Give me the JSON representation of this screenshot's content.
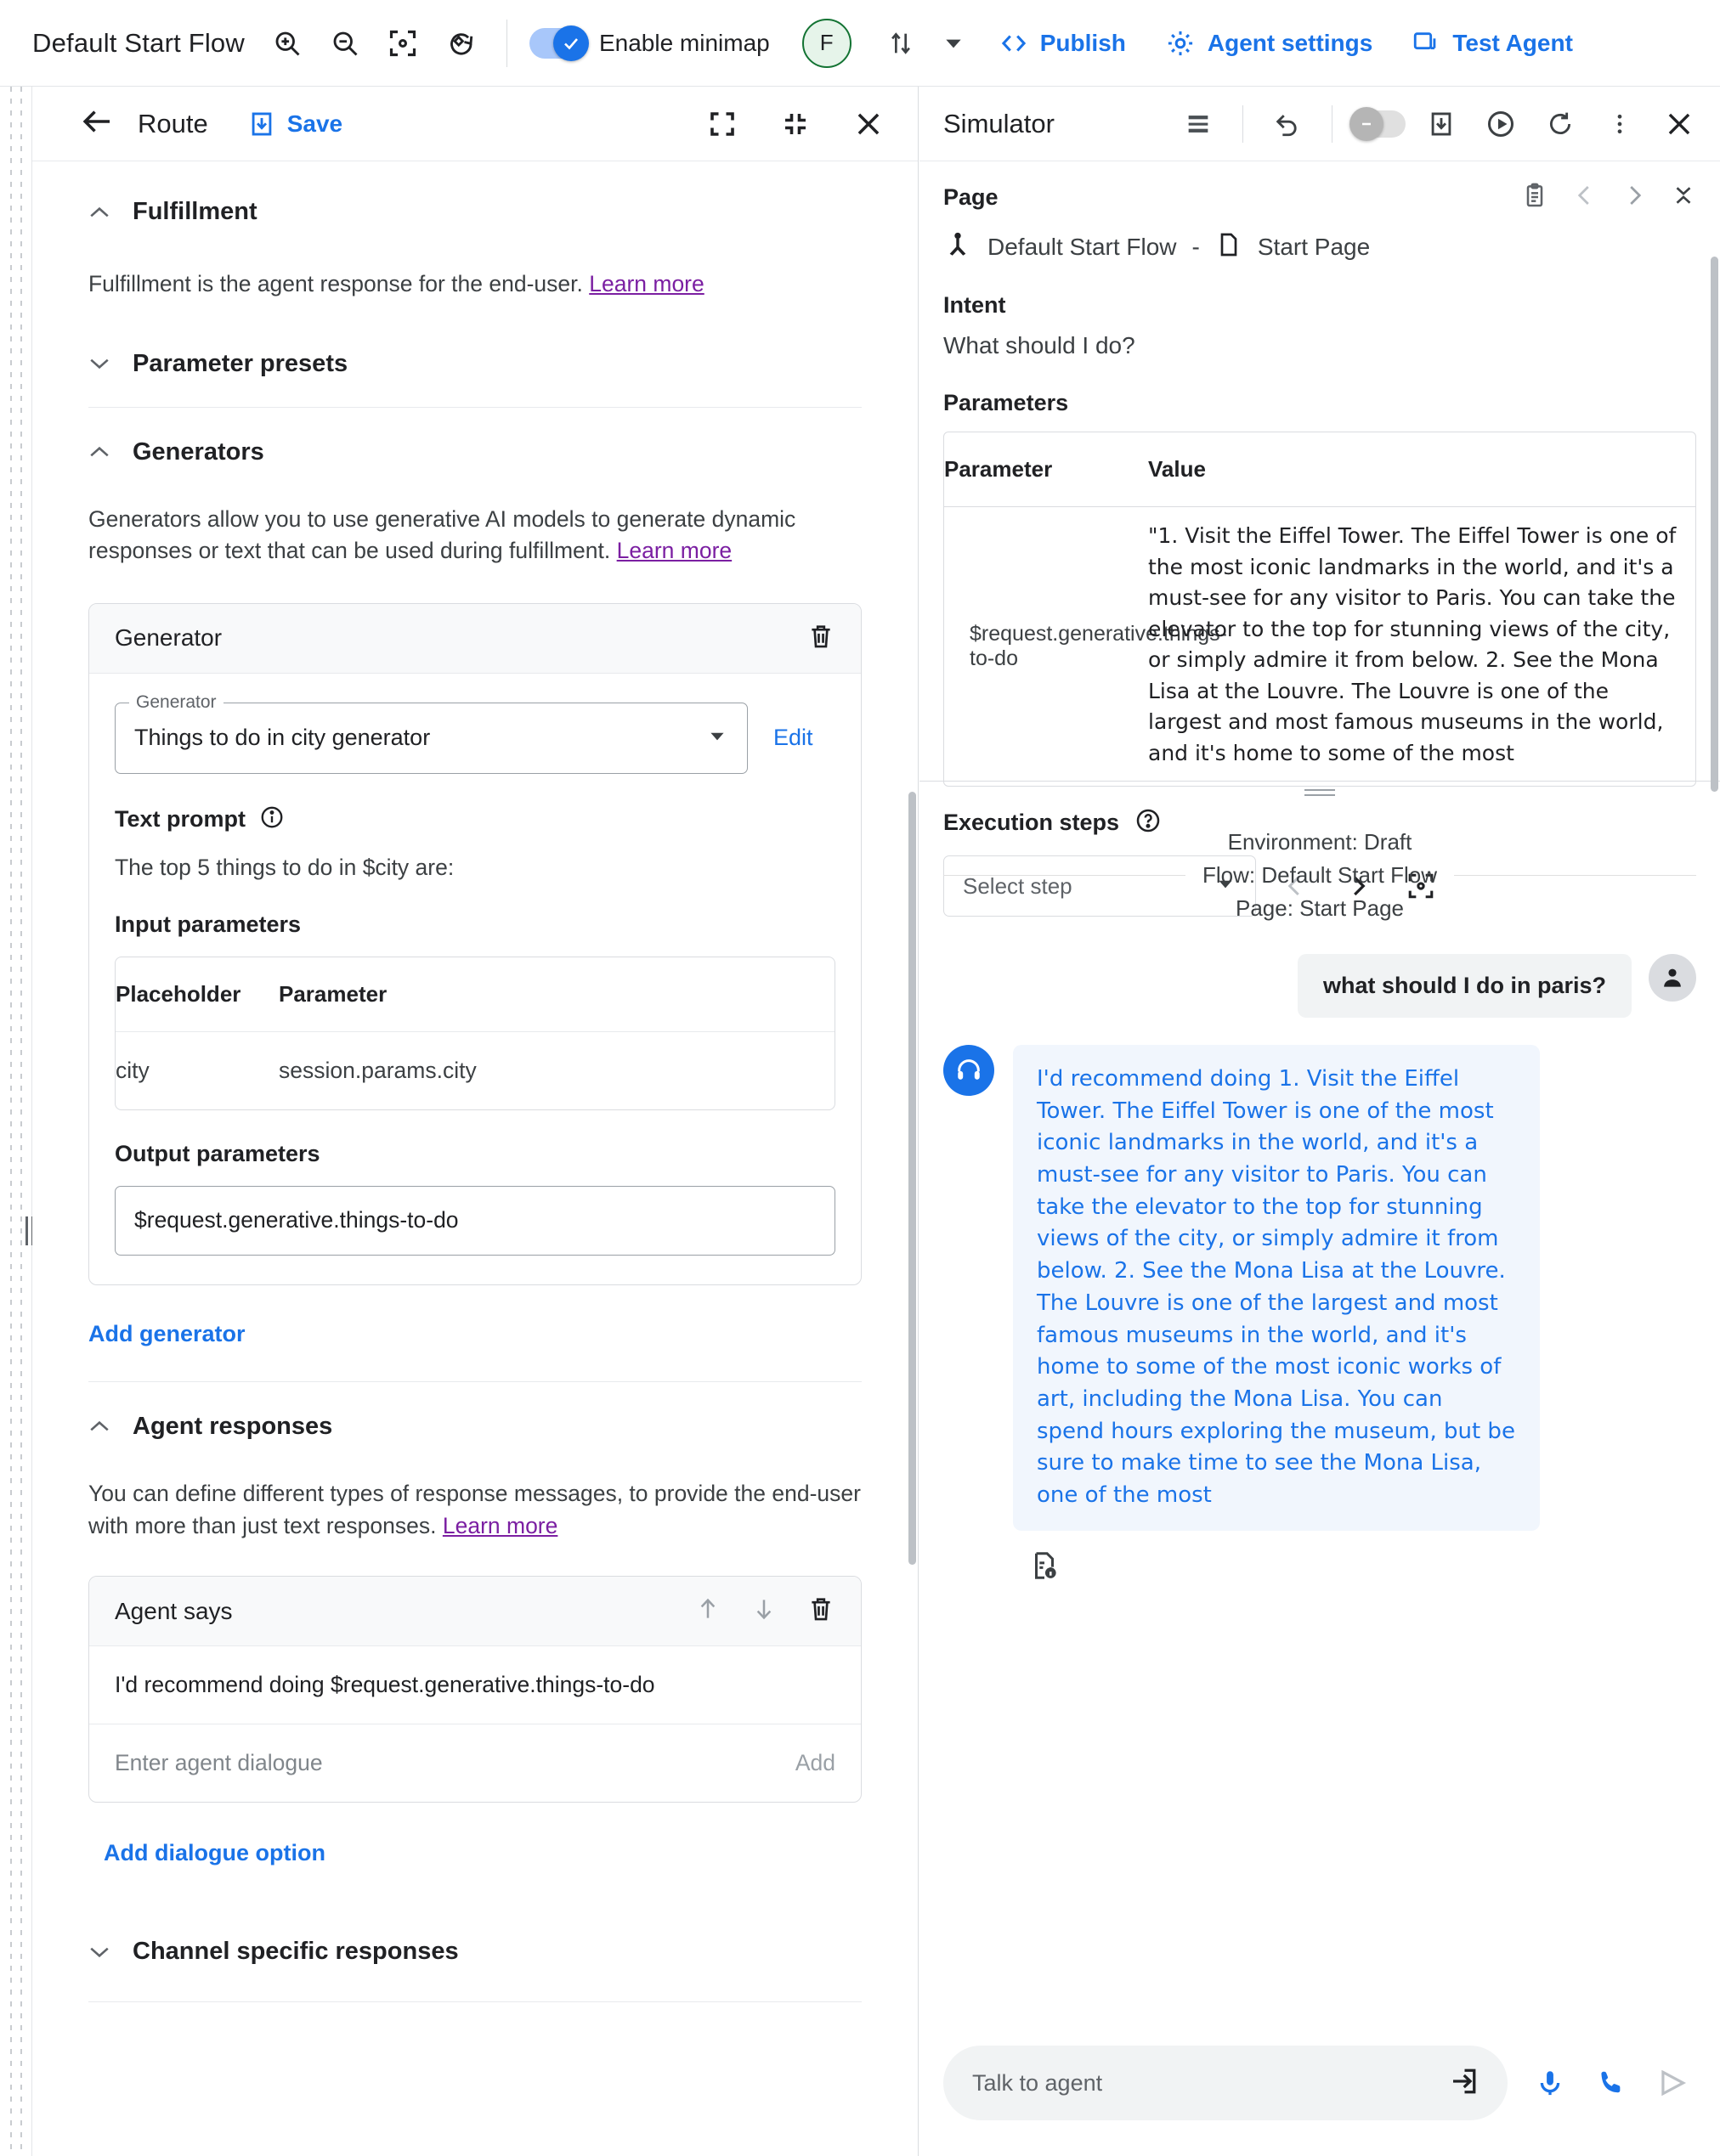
{
  "topbar": {
    "flow_title": "Default Start Flow",
    "icons": [
      "zoom-in-icon",
      "zoom-out-icon",
      "fit-to-screen-icon",
      "reset-view-icon"
    ],
    "minimap_label": "Enable minimap",
    "minimap_enabled": true,
    "avatar_initial": "F",
    "version_label": "",
    "publish_label": "Publish",
    "agent_settings_label": "Agent settings",
    "test_agent_label": "Test Agent",
    "accent_color": "#1a73e8"
  },
  "route": {
    "title": "Route",
    "save_label": "Save",
    "fulfillment": {
      "title": "Fulfillment",
      "description": "Fulfillment is the agent response for the end-user.",
      "learn_more": "Learn more"
    },
    "parameter_presets": {
      "title": "Parameter presets"
    },
    "generators": {
      "title": "Generators",
      "description": "Generators allow you to use generative AI models to generate dynamic responses or text that can be used during fulfillment.",
      "learn_more": "Learn more",
      "card_title": "Generator",
      "field_legend": "Generator",
      "field_value": "Things to do in city generator",
      "edit_label": "Edit",
      "text_prompt_label": "Text prompt",
      "prompt_value": "The top 5 things to do in $city are:",
      "input_parameters_label": "Input parameters",
      "input_table": {
        "headers": [
          "Placeholder",
          "Parameter"
        ],
        "rows": [
          [
            "city",
            "session.params.city"
          ]
        ]
      },
      "output_parameters_label": "Output parameters",
      "output_value": "$request.generative.things-to-do",
      "add_generator_label": "Add generator"
    },
    "agent_responses": {
      "title": "Agent responses",
      "description": "You can define different types of response messages, to provide the end-user with more than just text responses.",
      "learn_more": "Learn more",
      "card_title": "Agent says",
      "dialogue_value": "I'd recommend doing  $request.generative.things-to-do",
      "dialogue_placeholder": "Enter agent dialogue",
      "add_label": "Add",
      "add_dialogue_option_label": "Add dialogue option"
    },
    "channel_specific": {
      "title": "Channel specific responses"
    }
  },
  "simulator": {
    "title": "Simulator",
    "page_label": "Page",
    "flow_name": "Default Start Flow",
    "separator": "-",
    "page_name": "Start Page",
    "intent_label": "Intent",
    "intent_value": "What should I do?",
    "parameters_label": "Parameters",
    "parameters_table": {
      "headers": [
        "Parameter",
        "Value"
      ],
      "rows": [
        {
          "key": "$request.generative.things-to-do",
          "value": "\"1. Visit the Eiffel Tower. The Eiffel Tower is one of the most iconic landmarks in the world, and it's a must-see for any visitor to Paris. You can take the elevator to the top for stunning views of the city, or simply admire it from below. 2. See the Mona Lisa at the Louvre. The Louvre is one of the largest and most famous museums in the world, and it's home to some of the most"
        }
      ]
    },
    "execution_steps_label": "Execution steps",
    "select_step_placeholder": "Select step",
    "environment_line": "Environment: Draft",
    "flow_line": "Flow: Default Start Flow",
    "page_line": "Page: Start Page",
    "messages": [
      {
        "role": "user",
        "text": "what should I do in paris?"
      },
      {
        "role": "agent",
        "text": "I'd recommend doing 1. Visit the Eiffel Tower. The Eiffel Tower is one of the most iconic landmarks in the world, and it's a must-see for any visitor to Paris. You can take the elevator to the top for stunning views of the city, or simply admire it from below.\n2. See the Mona Lisa at the Louvre. The Louvre is one of the largest and most famous museums in the world, and it's home to some of the most iconic works of art, including the Mona Lisa. You can spend hours exploring the museum, but be sure to make time to see the Mona Lisa, one of the most"
      }
    ],
    "input_placeholder": "Talk to agent"
  }
}
